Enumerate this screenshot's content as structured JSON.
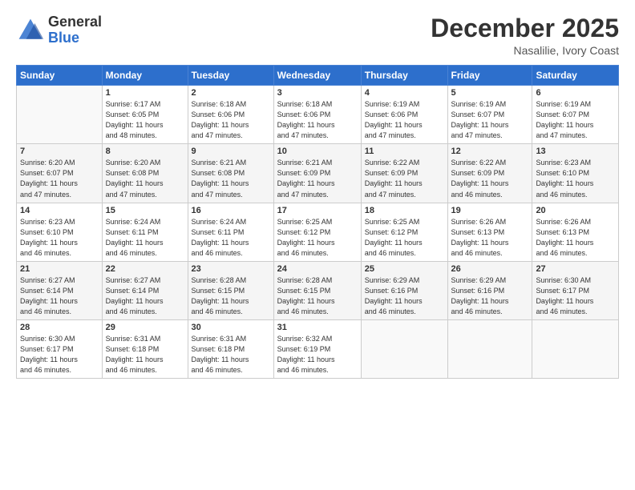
{
  "header": {
    "logo_general": "General",
    "logo_blue": "Blue",
    "title": "December 2025",
    "location": "Nasalilie, Ivory Coast"
  },
  "days_of_week": [
    "Sunday",
    "Monday",
    "Tuesday",
    "Wednesday",
    "Thursday",
    "Friday",
    "Saturday"
  ],
  "weeks": [
    [
      {
        "date": "",
        "sunrise": "",
        "sunset": "",
        "daylight": ""
      },
      {
        "date": "1",
        "sunrise": "6:17 AM",
        "sunset": "6:05 PM",
        "daylight": "11 hours and 48 minutes."
      },
      {
        "date": "2",
        "sunrise": "6:18 AM",
        "sunset": "6:06 PM",
        "daylight": "11 hours and 47 minutes."
      },
      {
        "date": "3",
        "sunrise": "6:18 AM",
        "sunset": "6:06 PM",
        "daylight": "11 hours and 47 minutes."
      },
      {
        "date": "4",
        "sunrise": "6:19 AM",
        "sunset": "6:06 PM",
        "daylight": "11 hours and 47 minutes."
      },
      {
        "date": "5",
        "sunrise": "6:19 AM",
        "sunset": "6:07 PM",
        "daylight": "11 hours and 47 minutes."
      },
      {
        "date": "6",
        "sunrise": "6:19 AM",
        "sunset": "6:07 PM",
        "daylight": "11 hours and 47 minutes."
      }
    ],
    [
      {
        "date": "7",
        "sunrise": "6:20 AM",
        "sunset": "6:07 PM",
        "daylight": "11 hours and 47 minutes."
      },
      {
        "date": "8",
        "sunrise": "6:20 AM",
        "sunset": "6:08 PM",
        "daylight": "11 hours and 47 minutes."
      },
      {
        "date": "9",
        "sunrise": "6:21 AM",
        "sunset": "6:08 PM",
        "daylight": "11 hours and 47 minutes."
      },
      {
        "date": "10",
        "sunrise": "6:21 AM",
        "sunset": "6:09 PM",
        "daylight": "11 hours and 47 minutes."
      },
      {
        "date": "11",
        "sunrise": "6:22 AM",
        "sunset": "6:09 PM",
        "daylight": "11 hours and 47 minutes."
      },
      {
        "date": "12",
        "sunrise": "6:22 AM",
        "sunset": "6:09 PM",
        "daylight": "11 hours and 46 minutes."
      },
      {
        "date": "13",
        "sunrise": "6:23 AM",
        "sunset": "6:10 PM",
        "daylight": "11 hours and 46 minutes."
      }
    ],
    [
      {
        "date": "14",
        "sunrise": "6:23 AM",
        "sunset": "6:10 PM",
        "daylight": "11 hours and 46 minutes."
      },
      {
        "date": "15",
        "sunrise": "6:24 AM",
        "sunset": "6:11 PM",
        "daylight": "11 hours and 46 minutes."
      },
      {
        "date": "16",
        "sunrise": "6:24 AM",
        "sunset": "6:11 PM",
        "daylight": "11 hours and 46 minutes."
      },
      {
        "date": "17",
        "sunrise": "6:25 AM",
        "sunset": "6:12 PM",
        "daylight": "11 hours and 46 minutes."
      },
      {
        "date": "18",
        "sunrise": "6:25 AM",
        "sunset": "6:12 PM",
        "daylight": "11 hours and 46 minutes."
      },
      {
        "date": "19",
        "sunrise": "6:26 AM",
        "sunset": "6:13 PM",
        "daylight": "11 hours and 46 minutes."
      },
      {
        "date": "20",
        "sunrise": "6:26 AM",
        "sunset": "6:13 PM",
        "daylight": "11 hours and 46 minutes."
      }
    ],
    [
      {
        "date": "21",
        "sunrise": "6:27 AM",
        "sunset": "6:14 PM",
        "daylight": "11 hours and 46 minutes."
      },
      {
        "date": "22",
        "sunrise": "6:27 AM",
        "sunset": "6:14 PM",
        "daylight": "11 hours and 46 minutes."
      },
      {
        "date": "23",
        "sunrise": "6:28 AM",
        "sunset": "6:15 PM",
        "daylight": "11 hours and 46 minutes."
      },
      {
        "date": "24",
        "sunrise": "6:28 AM",
        "sunset": "6:15 PM",
        "daylight": "11 hours and 46 minutes."
      },
      {
        "date": "25",
        "sunrise": "6:29 AM",
        "sunset": "6:16 PM",
        "daylight": "11 hours and 46 minutes."
      },
      {
        "date": "26",
        "sunrise": "6:29 AM",
        "sunset": "6:16 PM",
        "daylight": "11 hours and 46 minutes."
      },
      {
        "date": "27",
        "sunrise": "6:30 AM",
        "sunset": "6:17 PM",
        "daylight": "11 hours and 46 minutes."
      }
    ],
    [
      {
        "date": "28",
        "sunrise": "6:30 AM",
        "sunset": "6:17 PM",
        "daylight": "11 hours and 46 minutes."
      },
      {
        "date": "29",
        "sunrise": "6:31 AM",
        "sunset": "6:18 PM",
        "daylight": "11 hours and 46 minutes."
      },
      {
        "date": "30",
        "sunrise": "6:31 AM",
        "sunset": "6:18 PM",
        "daylight": "11 hours and 46 minutes."
      },
      {
        "date": "31",
        "sunrise": "6:32 AM",
        "sunset": "6:19 PM",
        "daylight": "11 hours and 46 minutes."
      },
      {
        "date": "",
        "sunrise": "",
        "sunset": "",
        "daylight": ""
      },
      {
        "date": "",
        "sunrise": "",
        "sunset": "",
        "daylight": ""
      },
      {
        "date": "",
        "sunrise": "",
        "sunset": "",
        "daylight": ""
      }
    ]
  ]
}
